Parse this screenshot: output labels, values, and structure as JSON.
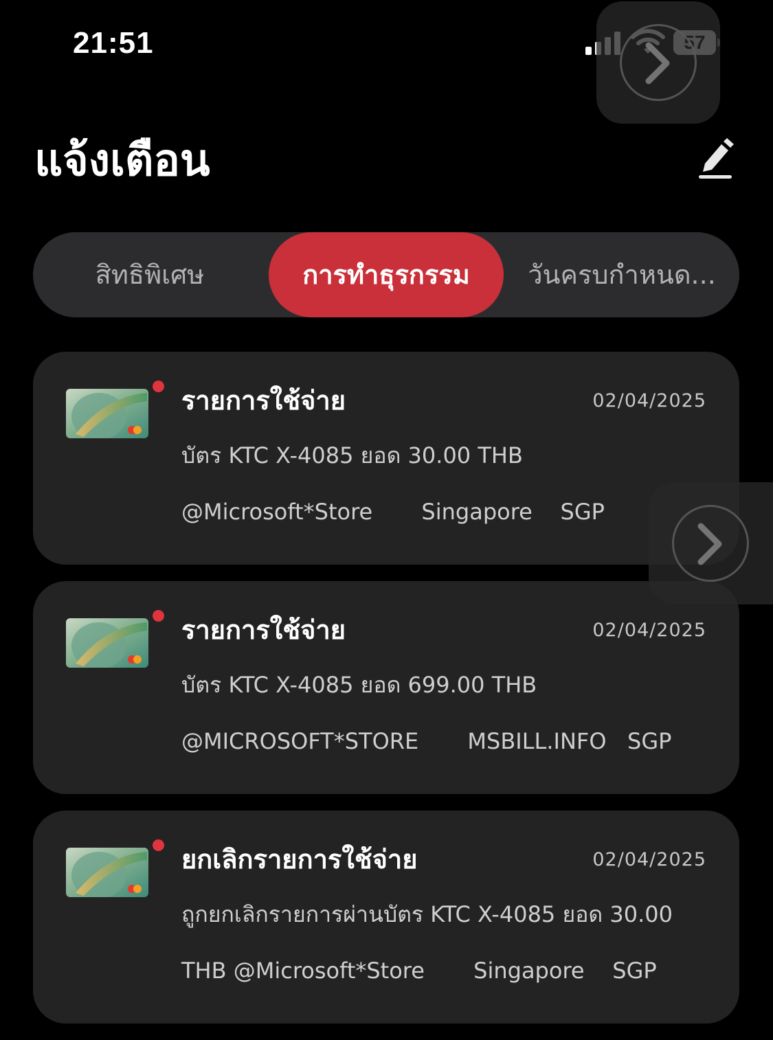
{
  "status_bar": {
    "time": "21:51",
    "battery": "57",
    "icons": [
      "cellular-signal-icon",
      "wifi-icon",
      "battery-icon"
    ]
  },
  "header": {
    "title": "แจ้งเตือน",
    "edit_icon": "edit-pencil-icon"
  },
  "tabs": [
    {
      "label": "สิทธิพิเศษ",
      "active": false
    },
    {
      "label": "การทำธุรกรรม",
      "active": true
    },
    {
      "label": "วันครบกำหนด...",
      "active": false
    }
  ],
  "notifications": [
    {
      "title": "รายการใช้จ่าย",
      "date": "02/04/2025",
      "line1": "บัตร KTC X-4085 ยอด 30.00 THB",
      "line2": "@Microsoft*Store       Singapore    SGP",
      "unread": true
    },
    {
      "title": "รายการใช้จ่าย",
      "date": "02/04/2025",
      "line1": "บัตร KTC X-4085 ยอด 699.00 THB",
      "line2": "@MICROSOFT*STORE       MSBILL.INFO   SGP",
      "unread": true
    },
    {
      "title": "ยกเลิกรายการใช้จ่าย",
      "date": "02/04/2025",
      "line1": "ถูกยกเลิกรายการผ่านบัตร KTC X-4085 ยอด 30.00",
      "line2": "THB @Microsoft*Store       Singapore    SGP",
      "unread": true
    }
  ],
  "colors": {
    "accent": "#c9303a",
    "unread_dot": "#e0343f",
    "card_bg": "#232323",
    "tab_bg": "#2c2c2e"
  }
}
